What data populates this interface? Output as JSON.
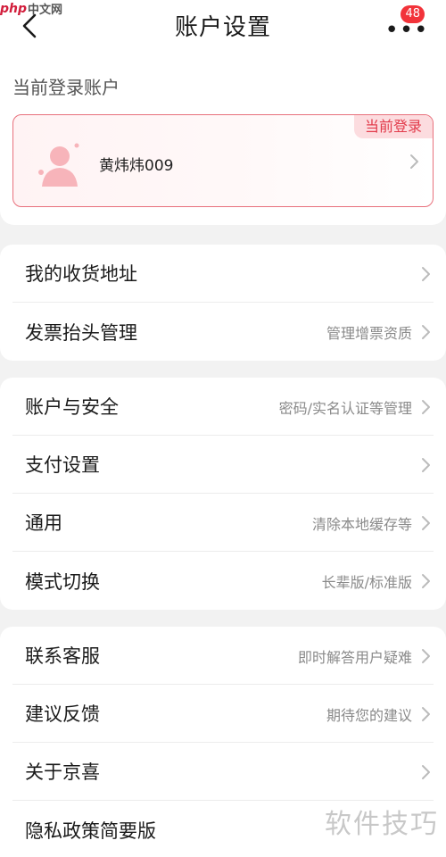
{
  "header": {
    "title": "账户设置",
    "badge_count": "48",
    "more_label": "•••"
  },
  "watermark": {
    "logo_text": "php",
    "logo_suffix": "中文网",
    "bottom_text": "软件技巧"
  },
  "account": {
    "section_title": "当前登录账户",
    "name": "黄炜炜009",
    "current_tag": "当前登录"
  },
  "groups": [
    [
      {
        "label": "我的收货地址",
        "sub": ""
      },
      {
        "label": "发票抬头管理",
        "sub": "管理增票资质"
      }
    ],
    [
      {
        "label": "账户与安全",
        "sub": "密码/实名认证等管理"
      },
      {
        "label": "支付设置",
        "sub": ""
      },
      {
        "label": "通用",
        "sub": "清除本地缓存等"
      },
      {
        "label": "模式切换",
        "sub": "长辈版/标准版"
      }
    ],
    [
      {
        "label": "联系客服",
        "sub": "即时解答用户疑难"
      },
      {
        "label": "建议反馈",
        "sub": "期待您的建议"
      },
      {
        "label": "关于京喜",
        "sub": ""
      },
      {
        "label": "隐私政策简要版",
        "sub": ""
      }
    ]
  ],
  "colors": {
    "accent": "#f2333a",
    "card_border": "#e8707c",
    "tag_bg": "#fcdcdf"
  }
}
